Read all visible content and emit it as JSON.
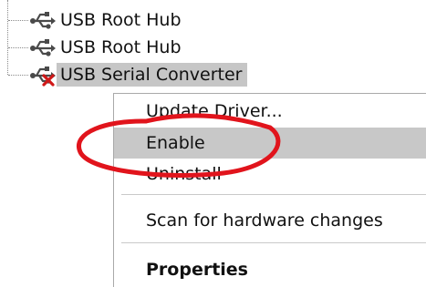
{
  "device_tree": {
    "items": [
      {
        "label": "USB Root Hub",
        "icon": "usb-icon",
        "disabled": false,
        "selected": false
      },
      {
        "label": "USB Root Hub",
        "icon": "usb-icon",
        "disabled": false,
        "selected": false
      },
      {
        "label": "USB Serial Converter",
        "icon": "usb-icon",
        "disabled": true,
        "selected": true
      }
    ]
  },
  "context_menu": {
    "items": [
      {
        "label": "Update Driver...",
        "highlighted": false,
        "bold": false
      },
      {
        "label": "Enable",
        "highlighted": true,
        "bold": false
      },
      {
        "label": "Uninstall",
        "highlighted": false,
        "bold": false
      },
      {
        "label": "Scan for hardware changes",
        "highlighted": false,
        "bold": false
      },
      {
        "label": "Properties",
        "highlighted": false,
        "bold": true
      }
    ]
  },
  "colors": {
    "selection_background": "#c6c6c6",
    "menu_highlight": "#c8c8c8",
    "annotation_red": "#e1141c",
    "disabled_mark_red": "#d01818",
    "usb_icon_gray": "#4a4a4a"
  }
}
